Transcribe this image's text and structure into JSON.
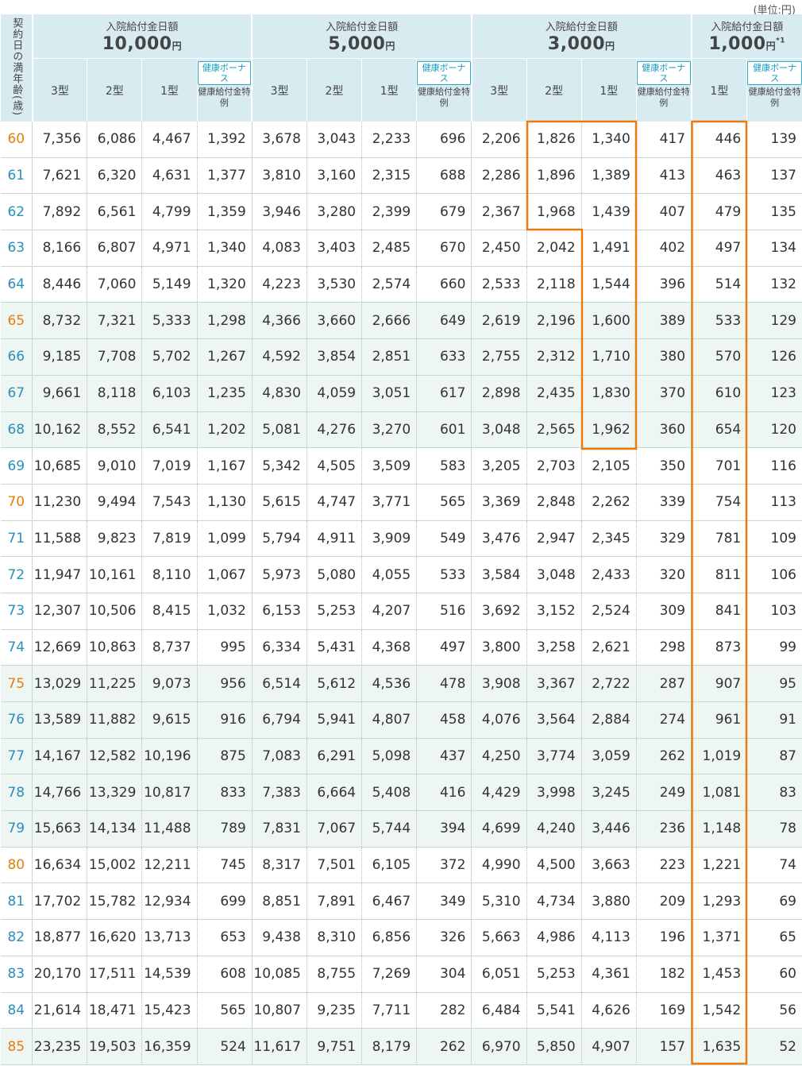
{
  "unit_note": "(単位:円)",
  "header": {
    "age_label": "契約日の満年齢(歳)",
    "groups": [
      {
        "title": "入院給付金日額",
        "amount": "10,000",
        "yen": "円",
        "note": ""
      },
      {
        "title": "入院給付金日額",
        "amount": "5,000",
        "yen": "円",
        "note": ""
      },
      {
        "title": "入院給付金日額",
        "amount": "3,000",
        "yen": "円",
        "note": ""
      },
      {
        "title": "入院給付金日額",
        "amount": "1,000",
        "yen": "円",
        "note": "*1"
      }
    ],
    "type3": "3型",
    "type2": "2型",
    "type1": "1型",
    "bonus_badge": "健康ボーナス",
    "bonus_sub": "健康給付金特例"
  },
  "accent_colors": {
    "highlight_border": "#e87d0d",
    "header_bg": "#d8ebf1",
    "age_orange": "#e87d0d",
    "age_blue": "#2a8fb8"
  },
  "rows": [
    {
      "age": "60",
      "v": [
        "7,356",
        "6,086",
        "4,467",
        "1,392",
        "3,678",
        "3,043",
        "2,233",
        "696",
        "2,206",
        "1,826",
        "1,340",
        "417",
        "446",
        "139"
      ]
    },
    {
      "age": "61",
      "v": [
        "7,621",
        "6,320",
        "4,631",
        "1,377",
        "3,810",
        "3,160",
        "2,315",
        "688",
        "2,286",
        "1,896",
        "1,389",
        "413",
        "463",
        "137"
      ]
    },
    {
      "age": "62",
      "v": [
        "7,892",
        "6,561",
        "4,799",
        "1,359",
        "3,946",
        "3,280",
        "2,399",
        "679",
        "2,367",
        "1,968",
        "1,439",
        "407",
        "479",
        "135"
      ]
    },
    {
      "age": "63",
      "v": [
        "8,166",
        "6,807",
        "4,971",
        "1,340",
        "4,083",
        "3,403",
        "2,485",
        "670",
        "2,450",
        "2,042",
        "1,491",
        "402",
        "497",
        "134"
      ]
    },
    {
      "age": "64",
      "v": [
        "8,446",
        "7,060",
        "5,149",
        "1,320",
        "4,223",
        "3,530",
        "2,574",
        "660",
        "2,533",
        "2,118",
        "1,544",
        "396",
        "514",
        "132"
      ]
    },
    {
      "age": "65",
      "v": [
        "8,732",
        "7,321",
        "5,333",
        "1,298",
        "4,366",
        "3,660",
        "2,666",
        "649",
        "2,619",
        "2,196",
        "1,600",
        "389",
        "533",
        "129"
      ]
    },
    {
      "age": "66",
      "v": [
        "9,185",
        "7,708",
        "5,702",
        "1,267",
        "4,592",
        "3,854",
        "2,851",
        "633",
        "2,755",
        "2,312",
        "1,710",
        "380",
        "570",
        "126"
      ]
    },
    {
      "age": "67",
      "v": [
        "9,661",
        "8,118",
        "6,103",
        "1,235",
        "4,830",
        "4,059",
        "3,051",
        "617",
        "2,898",
        "2,435",
        "1,830",
        "370",
        "610",
        "123"
      ]
    },
    {
      "age": "68",
      "v": [
        "10,162",
        "8,552",
        "6,541",
        "1,202",
        "5,081",
        "4,276",
        "3,270",
        "601",
        "3,048",
        "2,565",
        "1,962",
        "360",
        "654",
        "120"
      ]
    },
    {
      "age": "69",
      "v": [
        "10,685",
        "9,010",
        "7,019",
        "1,167",
        "5,342",
        "4,505",
        "3,509",
        "583",
        "3,205",
        "2,703",
        "2,105",
        "350",
        "701",
        "116"
      ]
    },
    {
      "age": "70",
      "v": [
        "11,230",
        "9,494",
        "7,543",
        "1,130",
        "5,615",
        "4,747",
        "3,771",
        "565",
        "3,369",
        "2,848",
        "2,262",
        "339",
        "754",
        "113"
      ]
    },
    {
      "age": "71",
      "v": [
        "11,588",
        "9,823",
        "7,819",
        "1,099",
        "5,794",
        "4,911",
        "3,909",
        "549",
        "3,476",
        "2,947",
        "2,345",
        "329",
        "781",
        "109"
      ]
    },
    {
      "age": "72",
      "v": [
        "11,947",
        "10,161",
        "8,110",
        "1,067",
        "5,973",
        "5,080",
        "4,055",
        "533",
        "3,584",
        "3,048",
        "2,433",
        "320",
        "811",
        "106"
      ]
    },
    {
      "age": "73",
      "v": [
        "12,307",
        "10,506",
        "8,415",
        "1,032",
        "6,153",
        "5,253",
        "4,207",
        "516",
        "3,692",
        "3,152",
        "2,524",
        "309",
        "841",
        "103"
      ]
    },
    {
      "age": "74",
      "v": [
        "12,669",
        "10,863",
        "8,737",
        "995",
        "6,334",
        "5,431",
        "4,368",
        "497",
        "3,800",
        "3,258",
        "2,621",
        "298",
        "873",
        "99"
      ]
    },
    {
      "age": "75",
      "v": [
        "13,029",
        "11,225",
        "9,073",
        "956",
        "6,514",
        "5,612",
        "4,536",
        "478",
        "3,908",
        "3,367",
        "2,722",
        "287",
        "907",
        "95"
      ]
    },
    {
      "age": "76",
      "v": [
        "13,589",
        "11,882",
        "9,615",
        "916",
        "6,794",
        "5,941",
        "4,807",
        "458",
        "4,076",
        "3,564",
        "2,884",
        "274",
        "961",
        "91"
      ]
    },
    {
      "age": "77",
      "v": [
        "14,167",
        "12,582",
        "10,196",
        "875",
        "7,083",
        "6,291",
        "5,098",
        "437",
        "4,250",
        "3,774",
        "3,059",
        "262",
        "1,019",
        "87"
      ]
    },
    {
      "age": "78",
      "v": [
        "14,766",
        "13,329",
        "10,817",
        "833",
        "7,383",
        "6,664",
        "5,408",
        "416",
        "4,429",
        "3,998",
        "3,245",
        "249",
        "1,081",
        "83"
      ]
    },
    {
      "age": "79",
      "v": [
        "15,663",
        "14,134",
        "11,488",
        "789",
        "7,831",
        "7,067",
        "5,744",
        "394",
        "4,699",
        "4,240",
        "3,446",
        "236",
        "1,148",
        "78"
      ]
    },
    {
      "age": "80",
      "v": [
        "16,634",
        "15,002",
        "12,211",
        "745",
        "8,317",
        "7,501",
        "6,105",
        "372",
        "4,990",
        "4,500",
        "3,663",
        "223",
        "1,221",
        "74"
      ]
    },
    {
      "age": "81",
      "v": [
        "17,702",
        "15,782",
        "12,934",
        "699",
        "8,851",
        "7,891",
        "6,467",
        "349",
        "5,310",
        "4,734",
        "3,880",
        "209",
        "1,293",
        "69"
      ]
    },
    {
      "age": "82",
      "v": [
        "18,877",
        "16,620",
        "13,713",
        "653",
        "9,438",
        "8,310",
        "6,856",
        "326",
        "5,663",
        "4,986",
        "4,113",
        "196",
        "1,371",
        "65"
      ]
    },
    {
      "age": "83",
      "v": [
        "20,170",
        "17,511",
        "14,539",
        "608",
        "10,085",
        "8,755",
        "7,269",
        "304",
        "6,051",
        "5,253",
        "4,361",
        "182",
        "1,453",
        "60"
      ]
    },
    {
      "age": "84",
      "v": [
        "21,614",
        "18,471",
        "15,423",
        "565",
        "10,807",
        "9,235",
        "7,711",
        "282",
        "6,484",
        "5,541",
        "4,626",
        "169",
        "1,542",
        "56"
      ]
    },
    {
      "age": "85",
      "v": [
        "23,235",
        "19,503",
        "16,359",
        "524",
        "11,617",
        "9,751",
        "8,179",
        "262",
        "6,970",
        "5,850",
        "4,907",
        "157",
        "1,635",
        "52"
      ]
    }
  ]
}
